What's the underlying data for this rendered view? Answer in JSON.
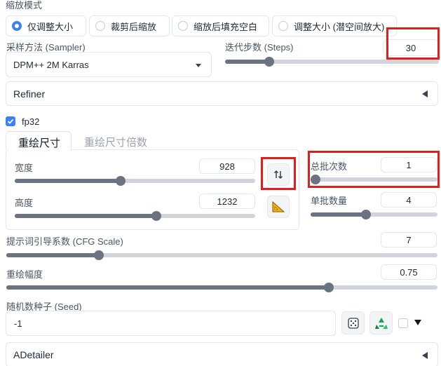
{
  "resize_mode": {
    "label": "缩放模式",
    "options": [
      "仅调整大小",
      "裁剪后缩放",
      "缩放后填充空白",
      "调整大小 (潜空间放大)"
    ],
    "selected": "仅调整大小"
  },
  "sampler": {
    "label": "采样方法 (Sampler)",
    "value": "DPM++ 2M Karras"
  },
  "steps": {
    "label": "迭代步数 (Steps)",
    "value": "30",
    "fraction": 0.2
  },
  "refiner": {
    "label": "Refiner"
  },
  "fp32": {
    "label": "fp32",
    "checked": true
  },
  "tabs": [
    "重绘尺寸",
    "重绘尺寸倍数"
  ],
  "width": {
    "label": "宽度",
    "value": "928",
    "fraction": 0.43
  },
  "height": {
    "label": "高度",
    "value": "1232",
    "fraction": 0.58
  },
  "batch_count": {
    "label": "总批次数",
    "value": "1",
    "fraction": 0.0
  },
  "batch_size": {
    "label": "单批数量",
    "value": "4",
    "fraction": 0.43
  },
  "cfg": {
    "label": "提示词引导系数 (CFG Scale)",
    "value": "7",
    "fraction": 0.21
  },
  "denoise": {
    "label": "重绘幅度",
    "value": "0.75",
    "fraction": 0.75
  },
  "seed": {
    "label": "随机数种子 (Seed)",
    "value": "-1"
  },
  "adetailer": {
    "label": "ADetailer"
  },
  "icons": {
    "swap": "swap-arrows-icon",
    "ratio": "triangle-ruler-icon",
    "dice": "dice-icon",
    "recycle": "recycle-icon"
  },
  "colors": {
    "highlight": "#e11d1d",
    "accent": "#3b82f6",
    "slider": "#6b7280"
  }
}
